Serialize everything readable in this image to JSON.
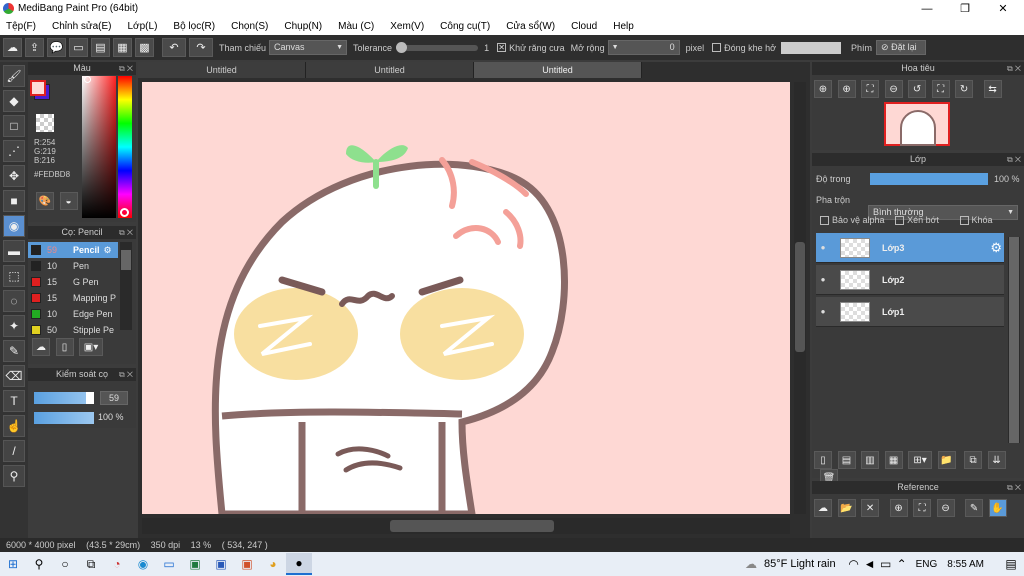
{
  "window": {
    "title": "MediBang Paint Pro (64bit)",
    "minimize": "—",
    "maximize": "❐",
    "close": "✕"
  },
  "menu": [
    "Tệp(F)",
    "Chỉnh sửa(E)",
    "Lớp(L)",
    "Bộ lọc(R)",
    "Chọn(S)",
    "Chụp(N)",
    "Màu (C)",
    "Xem(V)",
    "Công cụ(T)",
    "Cửa sổ(W)",
    "Cloud",
    "Help"
  ],
  "toolbar": {
    "reference_label": "Tham chiếu",
    "reference_value": "Canvas",
    "tolerance_label": "Tolerance",
    "tolerance_value": "1",
    "antialias_label": "Khử răng cưa",
    "expand_label": "Mở rộng",
    "expand_value": "0",
    "expand_unit": "pixel",
    "gap_label": "Đóng khe hở",
    "key_label": "Phím",
    "reset_label": "Đặt lại"
  },
  "color_panel": {
    "title": "Màu",
    "r": "R:254",
    "g": "G:219",
    "b": "B:216",
    "hex": "#FEDBD8",
    "primary_color": "#fedbd8",
    "secondary_color": "#4b1fd1"
  },
  "brush_panel": {
    "title": "Cọ: Pencil",
    "brushes": [
      {
        "size": "59",
        "name": "Pencil",
        "color": "#222222",
        "selected": true
      },
      {
        "size": "10",
        "name": "Pen",
        "color": "#222222"
      },
      {
        "size": "15",
        "name": "G Pen",
        "color": "#e02020"
      },
      {
        "size": "15",
        "name": "Mapping P",
        "color": "#e02020"
      },
      {
        "size": "10",
        "name": "Edge Pen",
        "color": "#22aa22"
      },
      {
        "size": "50",
        "name": "Stipple Pe",
        "color": "#e0d020"
      }
    ]
  },
  "brush_control": {
    "title": "Kiểm soát cọ",
    "size_value": "59",
    "opacity_value": "100 %"
  },
  "tabs": [
    "Untitled",
    "Untitled",
    "Untitled"
  ],
  "navigator": {
    "title": "Hoa tiêu"
  },
  "layer_panel": {
    "title": "Lớp",
    "opacity_label": "Độ trong",
    "opacity_value": "100 %",
    "blend_label": "Pha trộn",
    "blend_value": "Bình thường",
    "protect_alpha": "Bảo vệ alpha",
    "clip": "Xén bớt",
    "lock": "Khóa",
    "layers": [
      {
        "name": "Lớp3",
        "selected": true
      },
      {
        "name": "Lớp2",
        "selected": false
      },
      {
        "name": "Lớp1",
        "selected": false
      }
    ]
  },
  "reference_panel": {
    "title": "Reference"
  },
  "status": {
    "size": "6000 * 4000 pixel",
    "physical": "(43.5 * 29cm)",
    "dpi": "350 dpi",
    "zoom": "13 %",
    "coords": "( 534, 247 )"
  },
  "taskbar": {
    "weather": "85°F  Light rain",
    "lang": "ENG",
    "time": "8:55 AM"
  }
}
